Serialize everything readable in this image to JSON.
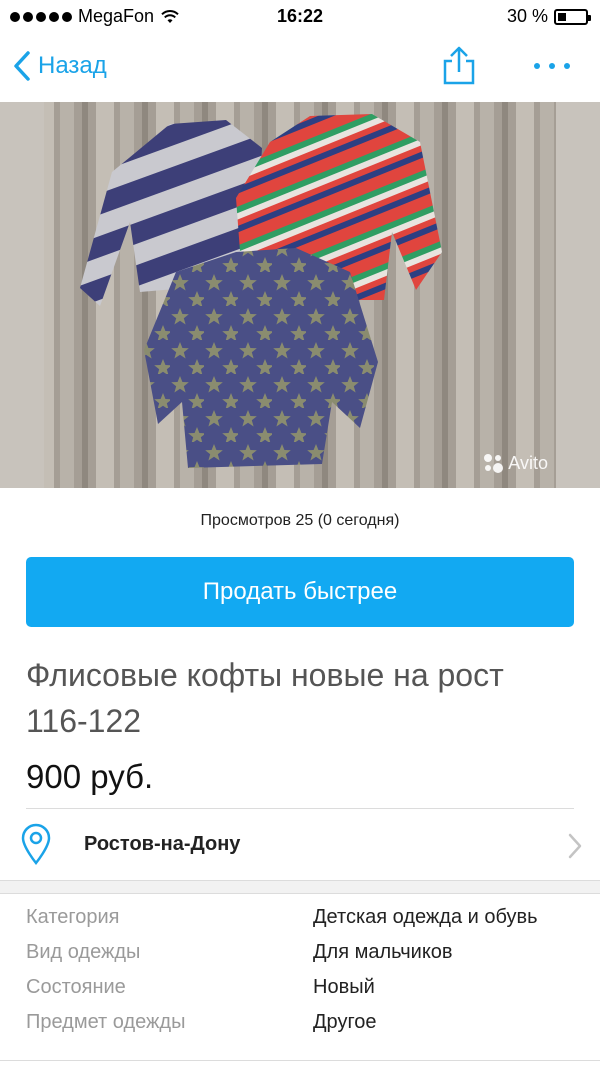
{
  "status_bar": {
    "carrier": "MegaFon",
    "time": "16:22",
    "battery_percent": "30 %",
    "battery_level": 0.3
  },
  "nav": {
    "back_label": "Назад",
    "icons": [
      "chevron-left-icon",
      "share-icon",
      "more-icon"
    ],
    "accent_color": "#1aa3e8"
  },
  "hero": {
    "watermark": "Avito"
  },
  "listing": {
    "views": "Просмотров 25 (0 сегодня)",
    "sell_button": "Продать быстрее",
    "title": "Флисовые кофты новые на рост 116-122",
    "price": "900 руб.",
    "location": "Ростов-на-Дону",
    "button_color": "#12a9f2"
  },
  "params": [
    {
      "key": "Категория",
      "value": "Детская одежда и обувь"
    },
    {
      "key": "Вид одежды",
      "value": "Для мальчиков"
    },
    {
      "key": "Состояние",
      "value": "Новый"
    },
    {
      "key": "Предмет одежды",
      "value": "Другое"
    }
  ]
}
